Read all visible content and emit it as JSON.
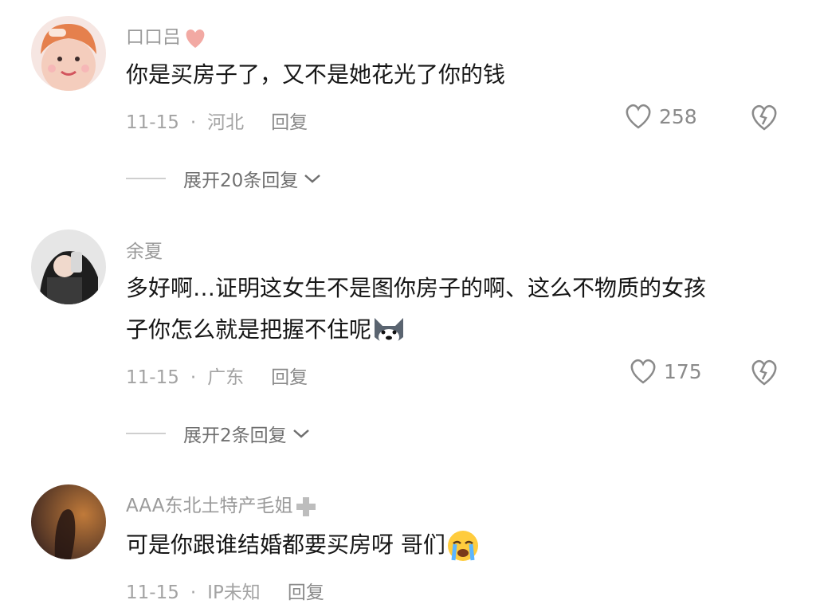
{
  "comments": [
    {
      "username": "口口吕",
      "text": "你是买房子了，又不是她花光了你的钱",
      "date": "11-15",
      "location": "河北",
      "reply_label": "回复",
      "likes": "258",
      "expand_label": "展开20条回复"
    },
    {
      "username": "余夏",
      "text_line1": "多好啊…证明这女生不是图你房子的啊、这么不物质的女孩",
      "text_line2": "子你怎么就是把握不住呢",
      "date": "11-15",
      "location": "广东",
      "reply_label": "回复",
      "likes": "175",
      "expand_label": "展开2条回复"
    },
    {
      "username": "AAA东北土特产毛姐",
      "text": "可是你跟谁结婚都要买房呀 哥们",
      "date": "11-15",
      "location": "IP未知",
      "reply_label": "回复"
    }
  ],
  "icons": {
    "like": "heart-outline-icon",
    "dislike": "broken-heart-icon",
    "expand": "chevron-down-icon",
    "emoji1": "husky-dog-emoji",
    "emoji2": "crying-face-emoji",
    "badge": "plus-badge-icon"
  },
  "colors": {
    "text": "#161616",
    "secondary": "#a3a3a3",
    "heart_badge": "#f2a9a3"
  }
}
